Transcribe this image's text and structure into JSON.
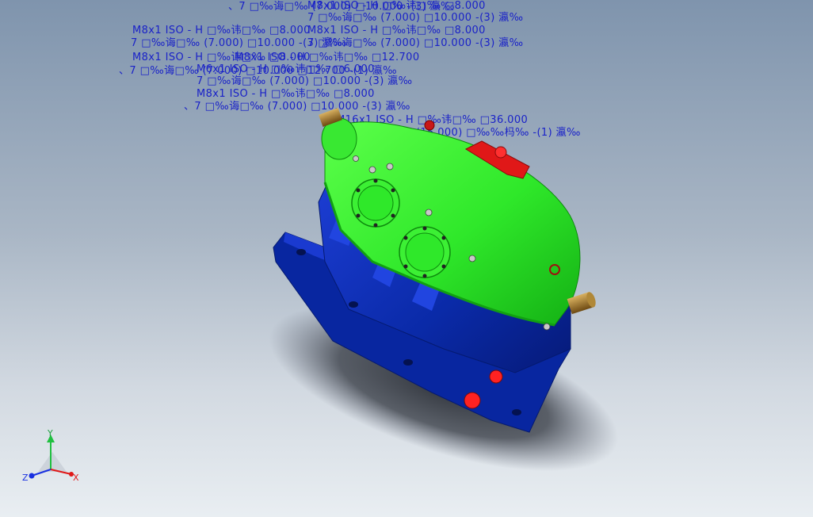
{
  "colors": {
    "annotation": "#1a22c8",
    "housing_lower": "#0a2aa8",
    "housing_upper": "#2fe82a",
    "inspection_cover": "#e01818",
    "shaft": "#a0782a",
    "axis_x": "#e01818",
    "axis_y": "#20c040",
    "axis_z": "#1830e0"
  },
  "model": {
    "name": "gear-reducer-assembly"
  },
  "annotations": [
    {
      "id": "a1",
      "text": "、7 □‰诲□‰ (7.000) □10.000 -(3) 瀛‰"
    },
    {
      "id": "a2",
      "text": "M8x1 ISO - H □‰讳□‰ □8.000"
    },
    {
      "id": "a3",
      "text": "7 □‰诲□‰ (7.000) □10.000 -(3) 瀛‰"
    },
    {
      "id": "a4",
      "text": "M8x1 ISO - H □‰讳□‰ □8.000"
    },
    {
      "id": "a5",
      "text": "7 □‰诲□‰ (7.000) □10.000 -(3) 瀛‰"
    },
    {
      "id": "a6",
      "text": "M8x1 ISO - H □‰讳□‰ □8.000"
    },
    {
      "id": "a7",
      "text": "7 □‰诲□‰ (7.000) □10.000 -(3) 瀛‰"
    },
    {
      "id": "a8",
      "text": "M8x1 ISO - H □‰讳□‰ □12.700"
    },
    {
      "id": "a9",
      "text": "、7 □‰诲□‰ (7.000) □10.000 □12.700 -(1) 瀛‰"
    },
    {
      "id": "a10",
      "text": "M6x1 ISO - H □‰讳□‰ □6.000"
    },
    {
      "id": "a11",
      "text": "7 □‰诲□‰ (7.000) □10.000 -(3) 瀛‰"
    },
    {
      "id": "a12",
      "text": "M8x1 ISO - H □‰讳□‰ □8.000"
    },
    {
      "id": "a13",
      "text": "、7 □‰诲□‰ (7.000) □10.000 -(3) 瀛‰"
    },
    {
      "id": "a14",
      "text": "M16x1 ISO - H □‰讳□‰ □36.000"
    },
    {
      "id": "a15",
      "text": "15 □‰诲□‰ (15.000) □‰‰杩‰ -(1) 瀛‰"
    },
    {
      "id": "a16",
      "text": "M8x1 ISO - H □‰讳□‰ □8.000"
    },
    {
      "id": "a17",
      "text": "M8x1 ISO - H □‰讳□‰ □8.000"
    },
    {
      "id": "a18",
      "text": "M6x1 ISO - H □‰讳□‰ □6.000"
    }
  ],
  "triad": {
    "x_label": "X",
    "y_label": "Y",
    "z_label": "Z"
  }
}
